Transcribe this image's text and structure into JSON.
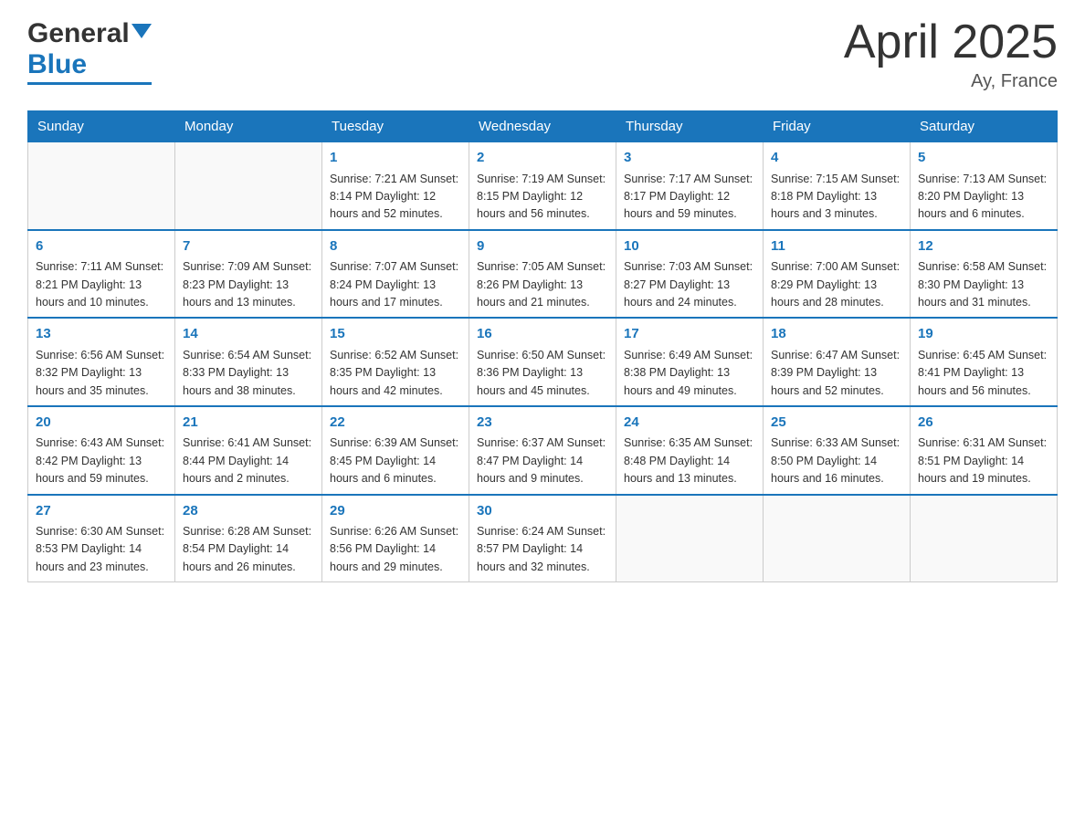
{
  "header": {
    "logo_general": "General",
    "logo_blue": "Blue",
    "month_title": "April 2025",
    "location": "Ay, France"
  },
  "weekdays": [
    "Sunday",
    "Monday",
    "Tuesday",
    "Wednesday",
    "Thursday",
    "Friday",
    "Saturday"
  ],
  "weeks": [
    {
      "days": [
        {
          "number": "",
          "info": ""
        },
        {
          "number": "",
          "info": ""
        },
        {
          "number": "1",
          "info": "Sunrise: 7:21 AM\nSunset: 8:14 PM\nDaylight: 12 hours\nand 52 minutes."
        },
        {
          "number": "2",
          "info": "Sunrise: 7:19 AM\nSunset: 8:15 PM\nDaylight: 12 hours\nand 56 minutes."
        },
        {
          "number": "3",
          "info": "Sunrise: 7:17 AM\nSunset: 8:17 PM\nDaylight: 12 hours\nand 59 minutes."
        },
        {
          "number": "4",
          "info": "Sunrise: 7:15 AM\nSunset: 8:18 PM\nDaylight: 13 hours\nand 3 minutes."
        },
        {
          "number": "5",
          "info": "Sunrise: 7:13 AM\nSunset: 8:20 PM\nDaylight: 13 hours\nand 6 minutes."
        }
      ]
    },
    {
      "days": [
        {
          "number": "6",
          "info": "Sunrise: 7:11 AM\nSunset: 8:21 PM\nDaylight: 13 hours\nand 10 minutes."
        },
        {
          "number": "7",
          "info": "Sunrise: 7:09 AM\nSunset: 8:23 PM\nDaylight: 13 hours\nand 13 minutes."
        },
        {
          "number": "8",
          "info": "Sunrise: 7:07 AM\nSunset: 8:24 PM\nDaylight: 13 hours\nand 17 minutes."
        },
        {
          "number": "9",
          "info": "Sunrise: 7:05 AM\nSunset: 8:26 PM\nDaylight: 13 hours\nand 21 minutes."
        },
        {
          "number": "10",
          "info": "Sunrise: 7:03 AM\nSunset: 8:27 PM\nDaylight: 13 hours\nand 24 minutes."
        },
        {
          "number": "11",
          "info": "Sunrise: 7:00 AM\nSunset: 8:29 PM\nDaylight: 13 hours\nand 28 minutes."
        },
        {
          "number": "12",
          "info": "Sunrise: 6:58 AM\nSunset: 8:30 PM\nDaylight: 13 hours\nand 31 minutes."
        }
      ]
    },
    {
      "days": [
        {
          "number": "13",
          "info": "Sunrise: 6:56 AM\nSunset: 8:32 PM\nDaylight: 13 hours\nand 35 minutes."
        },
        {
          "number": "14",
          "info": "Sunrise: 6:54 AM\nSunset: 8:33 PM\nDaylight: 13 hours\nand 38 minutes."
        },
        {
          "number": "15",
          "info": "Sunrise: 6:52 AM\nSunset: 8:35 PM\nDaylight: 13 hours\nand 42 minutes."
        },
        {
          "number": "16",
          "info": "Sunrise: 6:50 AM\nSunset: 8:36 PM\nDaylight: 13 hours\nand 45 minutes."
        },
        {
          "number": "17",
          "info": "Sunrise: 6:49 AM\nSunset: 8:38 PM\nDaylight: 13 hours\nand 49 minutes."
        },
        {
          "number": "18",
          "info": "Sunrise: 6:47 AM\nSunset: 8:39 PM\nDaylight: 13 hours\nand 52 minutes."
        },
        {
          "number": "19",
          "info": "Sunrise: 6:45 AM\nSunset: 8:41 PM\nDaylight: 13 hours\nand 56 minutes."
        }
      ]
    },
    {
      "days": [
        {
          "number": "20",
          "info": "Sunrise: 6:43 AM\nSunset: 8:42 PM\nDaylight: 13 hours\nand 59 minutes."
        },
        {
          "number": "21",
          "info": "Sunrise: 6:41 AM\nSunset: 8:44 PM\nDaylight: 14 hours\nand 2 minutes."
        },
        {
          "number": "22",
          "info": "Sunrise: 6:39 AM\nSunset: 8:45 PM\nDaylight: 14 hours\nand 6 minutes."
        },
        {
          "number": "23",
          "info": "Sunrise: 6:37 AM\nSunset: 8:47 PM\nDaylight: 14 hours\nand 9 minutes."
        },
        {
          "number": "24",
          "info": "Sunrise: 6:35 AM\nSunset: 8:48 PM\nDaylight: 14 hours\nand 13 minutes."
        },
        {
          "number": "25",
          "info": "Sunrise: 6:33 AM\nSunset: 8:50 PM\nDaylight: 14 hours\nand 16 minutes."
        },
        {
          "number": "26",
          "info": "Sunrise: 6:31 AM\nSunset: 8:51 PM\nDaylight: 14 hours\nand 19 minutes."
        }
      ]
    },
    {
      "days": [
        {
          "number": "27",
          "info": "Sunrise: 6:30 AM\nSunset: 8:53 PM\nDaylight: 14 hours\nand 23 minutes."
        },
        {
          "number": "28",
          "info": "Sunrise: 6:28 AM\nSunset: 8:54 PM\nDaylight: 14 hours\nand 26 minutes."
        },
        {
          "number": "29",
          "info": "Sunrise: 6:26 AM\nSunset: 8:56 PM\nDaylight: 14 hours\nand 29 minutes."
        },
        {
          "number": "30",
          "info": "Sunrise: 6:24 AM\nSunset: 8:57 PM\nDaylight: 14 hours\nand 32 minutes."
        },
        {
          "number": "",
          "info": ""
        },
        {
          "number": "",
          "info": ""
        },
        {
          "number": "",
          "info": ""
        }
      ]
    }
  ]
}
